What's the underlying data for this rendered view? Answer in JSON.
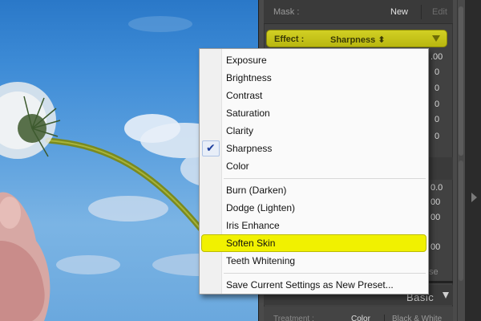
{
  "panel": {
    "mask_label": "Mask :",
    "mask_new": "New",
    "mask_edit": "Edit",
    "effect_label": "Effect :",
    "effect_value": "Sharpness",
    "effect_arrows": "⬍",
    "values": [
      ".00",
      "0",
      "0",
      "0",
      "0",
      "0",
      "0.0",
      "00",
      "00",
      "00",
      "se"
    ],
    "basic_label": "Basic",
    "treatment_label": "Treatment :",
    "treatment_color": "Color",
    "treatment_bw": "Black & White"
  },
  "menu": {
    "group1": [
      {
        "label": "Exposure",
        "checked": false
      },
      {
        "label": "Brightness",
        "checked": false
      },
      {
        "label": "Contrast",
        "checked": false
      },
      {
        "label": "Saturation",
        "checked": false
      },
      {
        "label": "Clarity",
        "checked": false
      },
      {
        "label": "Sharpness",
        "checked": true
      },
      {
        "label": "Color",
        "checked": false
      }
    ],
    "group2": [
      {
        "label": "Burn (Darken)"
      },
      {
        "label": "Dodge (Lighten)"
      },
      {
        "label": "Iris Enhance"
      },
      {
        "label": "Soften Skin",
        "highlighted": true
      },
      {
        "label": "Teeth Whitening"
      }
    ],
    "save_preset": "Save Current Settings as New Preset...",
    "check_glyph": "✔"
  },
  "colors": {
    "effect_bg": "#c8c61a",
    "highlight": "#f1f100",
    "check": "#1e3f9e",
    "panel_bg": "#414141"
  }
}
